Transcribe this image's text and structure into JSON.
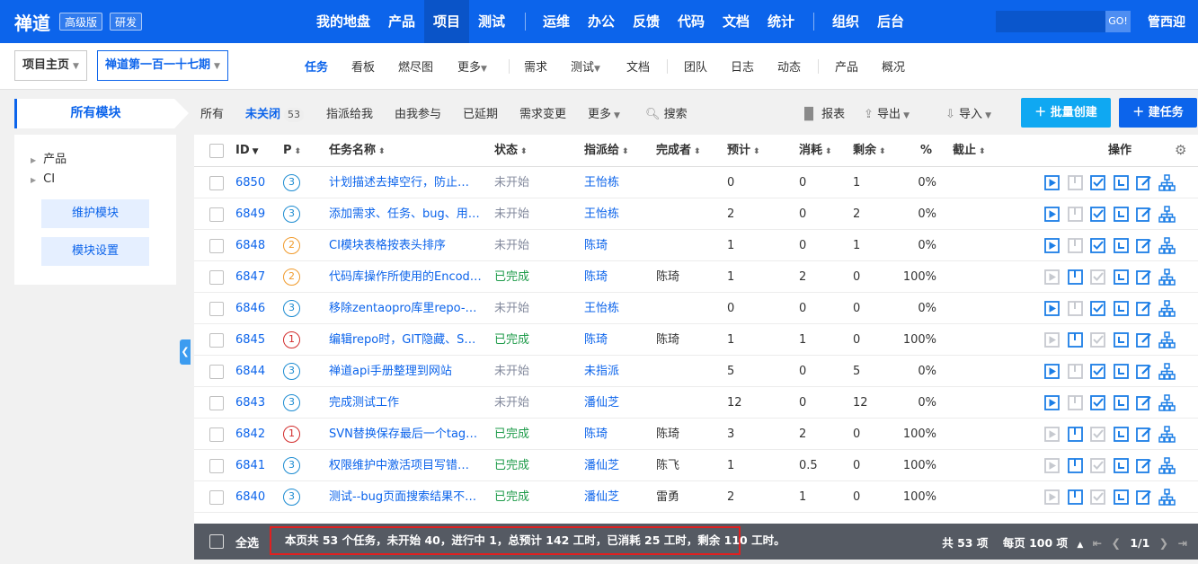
{
  "app": {
    "brand": "禅道",
    "edition": "高级版",
    "mode": "研发",
    "search_go": "GO!",
    "user": "管西迎"
  },
  "nav": [
    "我的地盘",
    "产品",
    "项目",
    "测试",
    "运维",
    "办公",
    "反馈",
    "代码",
    "文档",
    "统计",
    "组织",
    "后台"
  ],
  "breadcrumb": {
    "home": "项目主页",
    "project": "禅道第一百一十七期"
  },
  "subnav": [
    "任务",
    "看板",
    "燃尽图",
    "更多",
    "需求",
    "测试",
    "文档",
    "团队",
    "日志",
    "动态",
    "产品",
    "概况"
  ],
  "side": {
    "title": "所有模块",
    "tree": [
      "产品",
      "CI"
    ],
    "buttons": [
      "维护模块",
      "模块设置"
    ]
  },
  "filters": {
    "all": "所有",
    "unclosed": "未关闭",
    "unclosed_count": "53",
    "assigned": "指派给我",
    "involved": "由我参与",
    "delayed": "已延期",
    "story_changed": "需求变更",
    "more": "更多",
    "search": "搜索"
  },
  "toolbar": {
    "report": "报表",
    "export": "导出",
    "import": "导入",
    "batch_create": "批量创建",
    "create": "建任务"
  },
  "columns": {
    "id": "ID",
    "pri": "P",
    "name": "任务名称",
    "status": "状态",
    "assigned": "指派给",
    "finished": "完成者",
    "estimate": "预计",
    "consumed": "消耗",
    "left": "剩余",
    "progress": "%",
    "deadline": "截止",
    "actions": "操作"
  },
  "rows": [
    {
      "id": "6850",
      "pri": "3",
      "name": "计划描述去掉空行，防止…",
      "status": "未开始",
      "assigned": "王怡栋",
      "finished": "",
      "estimate": "0",
      "consumed": "0",
      "left": "1",
      "progress": "0%"
    },
    {
      "id": "6849",
      "pri": "3",
      "name": "添加需求、任务、bug、用…",
      "status": "未开始",
      "assigned": "王怡栋",
      "finished": "",
      "estimate": "2",
      "consumed": "0",
      "left": "2",
      "progress": "0%"
    },
    {
      "id": "6848",
      "pri": "2",
      "name": "CI模块表格按表头排序",
      "status": "未开始",
      "assigned": "陈琦",
      "finished": "",
      "estimate": "1",
      "consumed": "0",
      "left": "1",
      "progress": "0%"
    },
    {
      "id": "6847",
      "pri": "2",
      "name": "代码库操作所使用的Encod…",
      "status": "已完成",
      "assigned": "陈琦",
      "finished": "陈琦",
      "estimate": "1",
      "consumed": "2",
      "left": "0",
      "progress": "100%"
    },
    {
      "id": "6846",
      "pri": "3",
      "name": "移除zentaopro库里repo->…",
      "status": "未开始",
      "assigned": "王怡栋",
      "finished": "",
      "estimate": "0",
      "consumed": "0",
      "left": "0",
      "progress": "0%"
    },
    {
      "id": "6845",
      "pri": "1",
      "name": "编辑repo时，GIT隐藏、S…",
      "status": "已完成",
      "assigned": "陈琦",
      "finished": "陈琦",
      "estimate": "1",
      "consumed": "1",
      "left": "0",
      "progress": "100%"
    },
    {
      "id": "6844",
      "pri": "3",
      "name": "禅道api手册整理到网站",
      "status": "未开始",
      "assigned": "未指派",
      "finished": "",
      "estimate": "5",
      "consumed": "0",
      "left": "5",
      "progress": "0%"
    },
    {
      "id": "6843",
      "pri": "3",
      "name": "完成测试工作",
      "status": "未开始",
      "assigned": "潘仙芝",
      "finished": "",
      "estimate": "12",
      "consumed": "0",
      "left": "12",
      "progress": "0%"
    },
    {
      "id": "6842",
      "pri": "1",
      "name": "SVN替换保存最后一个tag…",
      "status": "已完成",
      "assigned": "陈琦",
      "finished": "陈琦",
      "estimate": "3",
      "consumed": "2",
      "left": "0",
      "progress": "100%"
    },
    {
      "id": "6841",
      "pri": "3",
      "name": "权限维护中激活项目写错…",
      "status": "已完成",
      "assigned": "潘仙芝",
      "finished": "陈飞",
      "estimate": "1",
      "consumed": "0.5",
      "left": "0",
      "progress": "100%"
    },
    {
      "id": "6840",
      "pri": "3",
      "name": "测试--bug页面搜索结果不…",
      "status": "已完成",
      "assigned": "潘仙芝",
      "finished": "雷勇",
      "estimate": "2",
      "consumed": "1",
      "left": "0",
      "progress": "100%"
    }
  ],
  "footer": {
    "select_all": "全选",
    "summary": "本页共 53 个任务，未开始 40，进行中 1，总预计 142 工时，已消耗 25 工时，剩余 110 工时。",
    "total": "共 53 项",
    "per_page": "每页 100 项",
    "page": "1/1"
  },
  "colors": {
    "brand": "#0c64eb",
    "pri1": "#d22a2a",
    "pri2": "#f09a2b",
    "pri3": "#1b8bd1",
    "done": "#1e9b4a",
    "todo": "#838a9d"
  }
}
